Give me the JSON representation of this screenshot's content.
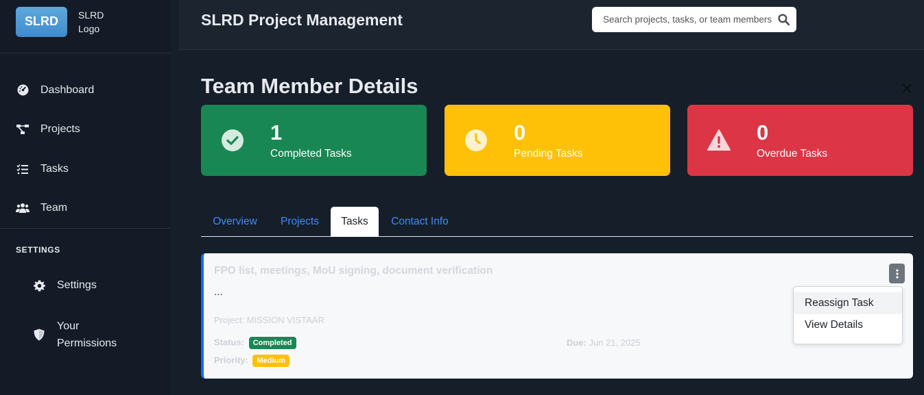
{
  "sidebar": {
    "logo_text": "SLRD",
    "logo_alt_line1": "SLRD",
    "logo_alt_line2": "Logo",
    "items": [
      {
        "label": "Dashboard",
        "icon": "dashboard-icon"
      },
      {
        "label": "Projects",
        "icon": "projects-icon"
      },
      {
        "label": "Tasks",
        "icon": "tasks-icon"
      },
      {
        "label": "Team",
        "icon": "team-icon"
      }
    ],
    "settings_heading": "SETTINGS",
    "settings_items": [
      {
        "label": "Settings",
        "icon": "gear-icon"
      },
      {
        "label_line1": "Your",
        "label_line2": "Permissions",
        "icon": "shield-icon"
      }
    ]
  },
  "header": {
    "title": "SLRD Project Management",
    "search_placeholder": "Search projects, tasks, or team members..."
  },
  "main": {
    "page_title": "Team Member Details",
    "stats": [
      {
        "value": "1",
        "label": "Completed Tasks",
        "color": "#198754",
        "icon": "check-circle-icon"
      },
      {
        "value": "0",
        "label": "Pending Tasks",
        "color": "#ffc107",
        "icon": "clock-icon"
      },
      {
        "value": "0",
        "label": "Overdue Tasks",
        "color": "#dc3545",
        "icon": "warning-icon"
      }
    ],
    "tabs": [
      {
        "label": "Overview"
      },
      {
        "label": "Projects"
      },
      {
        "label": "Tasks",
        "active": true
      },
      {
        "label": "Contact Info"
      }
    ],
    "task": {
      "title": "FPO list, meetings, MoU signing, document verification",
      "description": "...",
      "project": "Project: MISSION VISTAAR",
      "status_label": "Status:",
      "status_value": "Completed",
      "priority_label": "Priority:",
      "priority_value": "Medium",
      "due_label": "Due:",
      "due_value": "Jun 21, 2025"
    },
    "menu": {
      "items": [
        "Reassign Task",
        "View Details"
      ]
    }
  }
}
